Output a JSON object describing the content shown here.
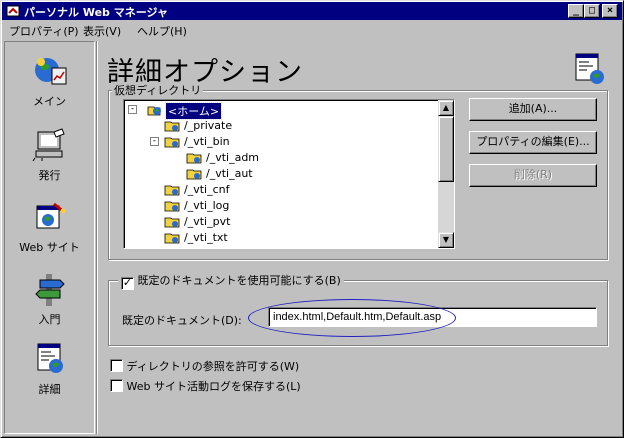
{
  "window": {
    "title": "パーソナル Web マネージャ",
    "buttons": {
      "minimize": "_",
      "maximize": "□",
      "close": "×"
    }
  },
  "menu": {
    "items": [
      {
        "label": "プロパティ(P)"
      },
      {
        "label": "表示(V)"
      },
      {
        "label": "ヘルプ(H)"
      }
    ]
  },
  "sidebar": {
    "items": [
      {
        "label": "メイン",
        "icon": "main-icon"
      },
      {
        "label": "発行",
        "icon": "publish-icon"
      },
      {
        "label": "Web サイト",
        "icon": "website-icon"
      },
      {
        "label": "入門",
        "icon": "tour-icon"
      },
      {
        "label": "詳細",
        "icon": "advanced-icon"
      }
    ]
  },
  "header": {
    "title": "詳細オプション"
  },
  "vdir": {
    "group_label": "仮想ディレクトリ",
    "tree": [
      {
        "label": "<ホーム>",
        "level": 0,
        "expander": "-",
        "selected": true
      },
      {
        "label": "/_private",
        "level": 1
      },
      {
        "label": "/_vti_bin",
        "level": 1,
        "expander": "-"
      },
      {
        "label": "/_vti_adm",
        "level": 2
      },
      {
        "label": "/_vti_aut",
        "level": 2
      },
      {
        "label": "/_vti_cnf",
        "level": 1
      },
      {
        "label": "/_vti_log",
        "level": 1
      },
      {
        "label": "/_vti_pvt",
        "level": 1
      },
      {
        "label": "/_vti_txt",
        "level": 1
      }
    ],
    "scroll_up": "▲",
    "scroll_down": "▼",
    "add_button": "追加(A)...",
    "edit_button": "プロパティの編集(E)...",
    "delete_button": "削除(R)"
  },
  "default_doc": {
    "enable_label": "既定のドキュメントを使用可能にする(B)",
    "enable_checked": true,
    "field_label": "既定のドキュメント(D):",
    "field_value": "index.html,Default.htm,Default.asp"
  },
  "options": {
    "dir_browse_label": "ディレクトリの参照を許可する(W)",
    "dir_browse_checked": false,
    "log_label": "Web サイト活動ログを保存する(L)",
    "log_checked": false
  },
  "colors": {
    "titlebar": "#000080",
    "face": "#c0c0c0",
    "highlight_ring": "#2020c0"
  }
}
